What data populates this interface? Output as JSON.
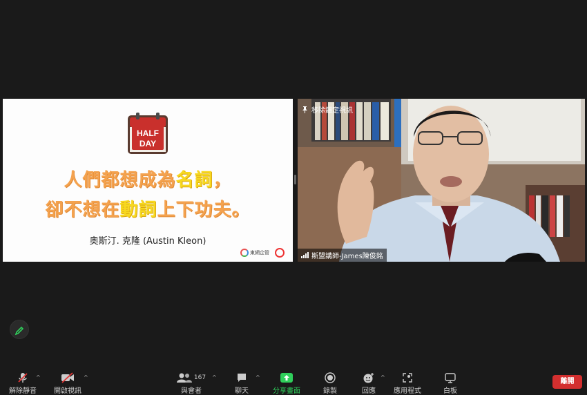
{
  "slide": {
    "calendar_top": "HALF",
    "calendar_bottom": "DAY",
    "quote_line1_a": "人們都想成為",
    "quote_line1_hl": "名詞",
    "quote_line1_b": "，",
    "quote_line2_a": "卻不想在",
    "quote_line2_hl": "動詞",
    "quote_line2_b": "上下功夫。",
    "attribution": "奧斯汀. 克隆 (Austin Kleon)",
    "logo_text": "東網企管"
  },
  "video": {
    "pin_label": "移除錨定視訊",
    "participant_name": "斯盟講師-James陳俊銘"
  },
  "toolbar": {
    "mute_label": "解除靜音",
    "video_label": "開啟視訊",
    "participants_label": "與會者",
    "participants_count": "167",
    "chat_label": "聊天",
    "share_label": "分享畫面",
    "record_label": "錄製",
    "reactions_label": "回應",
    "apps_label": "應用程式",
    "whiteboard_label": "白板",
    "leave_label": "離開"
  },
  "colors": {
    "background": "#1a1a1a",
    "share_green": "#2fcf5b",
    "leave_red": "#d32f2f",
    "quote_orange": "#f4a24e",
    "quote_yellow": "#f7d81f"
  }
}
